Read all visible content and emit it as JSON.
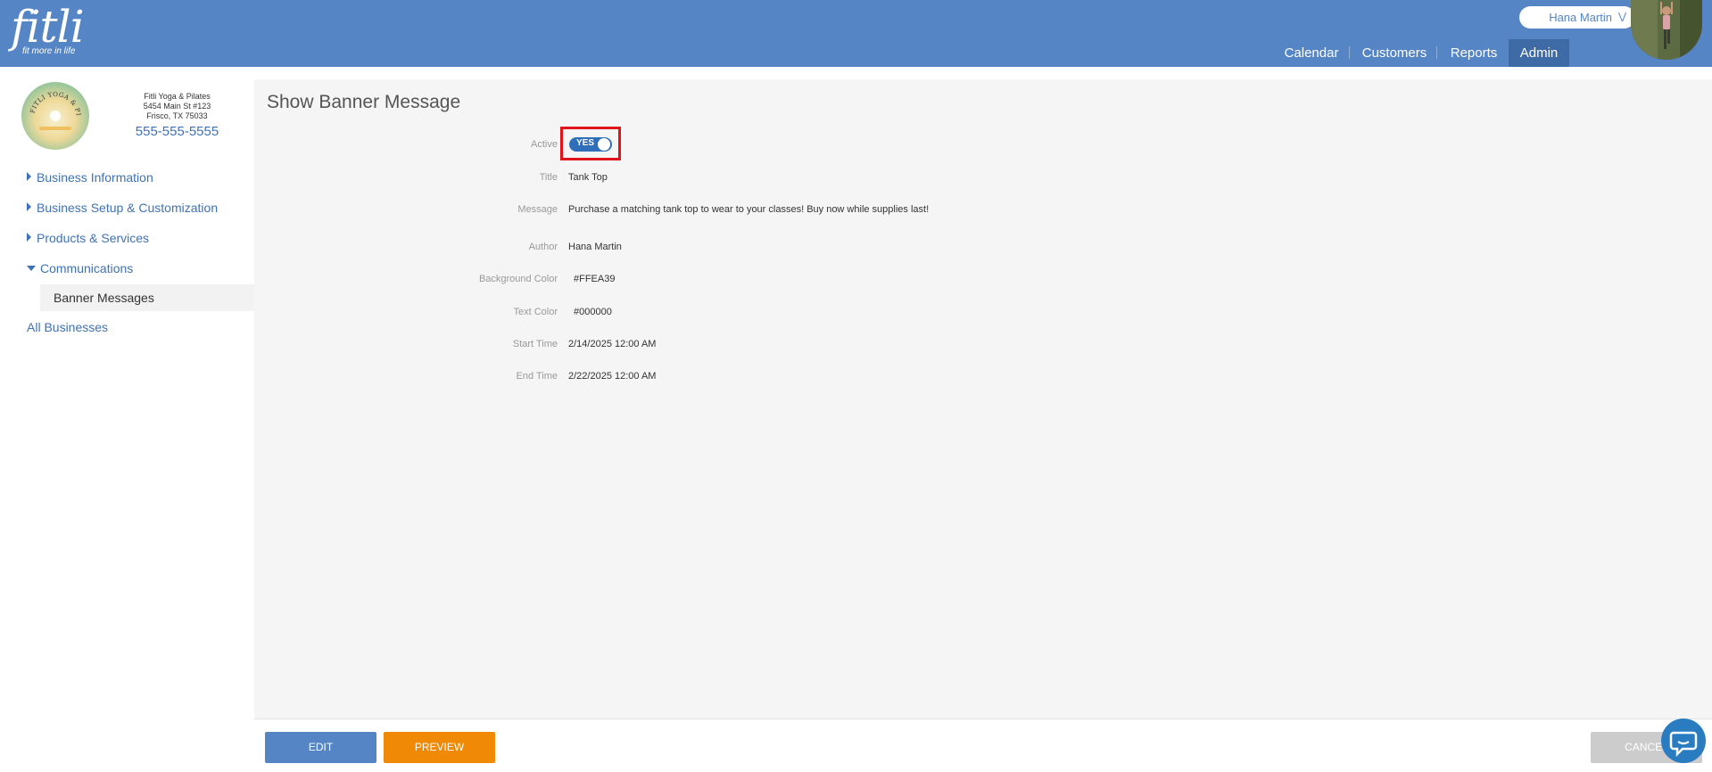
{
  "header": {
    "logo_text": "fitli",
    "logo_tagline": "fit more in life",
    "user_name": "Hana Martin",
    "nav": [
      {
        "label": "Calendar"
      },
      {
        "label": "Customers"
      },
      {
        "label": "Reports"
      },
      {
        "label": "Admin",
        "active": true
      }
    ],
    "bar_color": "#5585c5"
  },
  "sidebar": {
    "business": {
      "name": "Fitli Yoga & Pilates",
      "address1": "5454 Main St #123",
      "address2": "Frisco, TX 75033",
      "phone": "555-555-5555",
      "logo_text": "FITLI YOGA & PILATES"
    },
    "menu": [
      {
        "label": "Business Information",
        "expanded": false
      },
      {
        "label": "Business Setup & Customization",
        "expanded": false
      },
      {
        "label": "Products & Services",
        "expanded": false
      },
      {
        "label": "Communications",
        "expanded": true
      },
      {
        "label": "All Businesses"
      }
    ],
    "submenu": [
      {
        "label": "Banner Messages",
        "selected": true
      }
    ]
  },
  "main": {
    "title": "Show Banner Message",
    "fields": {
      "active": {
        "label": "Active",
        "value": "YES"
      },
      "title": {
        "label": "Title",
        "value": "Tank Top"
      },
      "message": {
        "label": "Message",
        "value": "Purchase a matching tank top to wear to your classes! Buy now while supplies last!"
      },
      "author": {
        "label": "Author",
        "value": "Hana Martin"
      },
      "background_color": {
        "label": "Background Color",
        "value": "#FFEA39"
      },
      "text_color": {
        "label": "Text Color",
        "value": "#000000"
      },
      "start_time": {
        "label": "Start Time",
        "value": "2/14/2025 12:00 AM"
      },
      "end_time": {
        "label": "End Time",
        "value": "2/22/2025 12:00 AM"
      }
    }
  },
  "footer": {
    "edit_label": "EDIT",
    "preview_label": "PREVIEW",
    "cancel_label": "CANCEL"
  },
  "colors": {
    "accent_blue": "#5585c5",
    "preview_orange": "#f08a06",
    "highlight_red": "#e0141b"
  },
  "icons": {
    "chevron": "chevron-down-icon",
    "chat": "chat-icon"
  }
}
